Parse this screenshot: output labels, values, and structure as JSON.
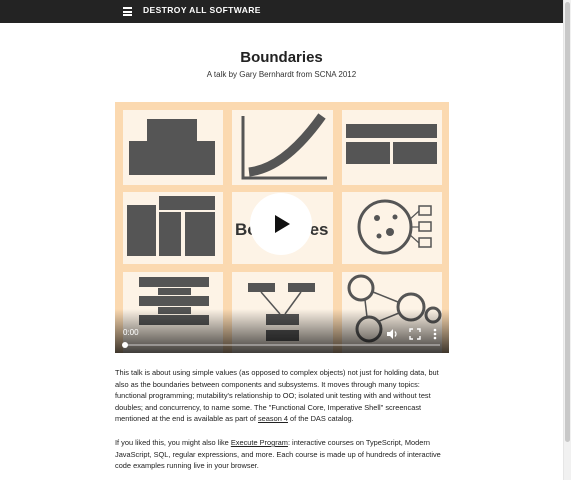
{
  "header": {
    "brand": "DESTROY ALL SOFTWARE",
    "menu_icon": "hamburger-menu-icon"
  },
  "page": {
    "title": "Boundaries",
    "subtitle": "A talk by Gary Bernhardt from SCNA 2012"
  },
  "video": {
    "poster_word": "Boundaries",
    "time": "0:00",
    "progress": 0,
    "icons": [
      "play-icon",
      "volume-icon",
      "fullscreen-icon",
      "more-options-icon"
    ]
  },
  "description": {
    "p1_before": "This talk is about using simple values (as opposed to complex objects) not just for holding data, but also as the boundaries between components and subsystems. It moves through many topics: functional programming; mutability's relationship to OO; isolated unit testing with and without test doubles; and concurrency, to name some. The \"Functional Core, Imperative Shell\" screencast mentioned at the end is available as part of ",
    "p1_link": "season 4",
    "p1_after": " of the DAS catalog.",
    "p2_before": "If you liked this, you might also like ",
    "p2_link": "Execute Program",
    "p2_after": ": interactive courses on TypeScript, Modern JavaScript, SQL, regular expressions, and more. Each course is made up of hundreds of interactive code examples running live in your browser."
  },
  "colors": {
    "topbar": "#232323",
    "poster_bg": "#fbd9b0",
    "poster_tile": "#fdf3e6",
    "poster_shape": "#555555"
  }
}
